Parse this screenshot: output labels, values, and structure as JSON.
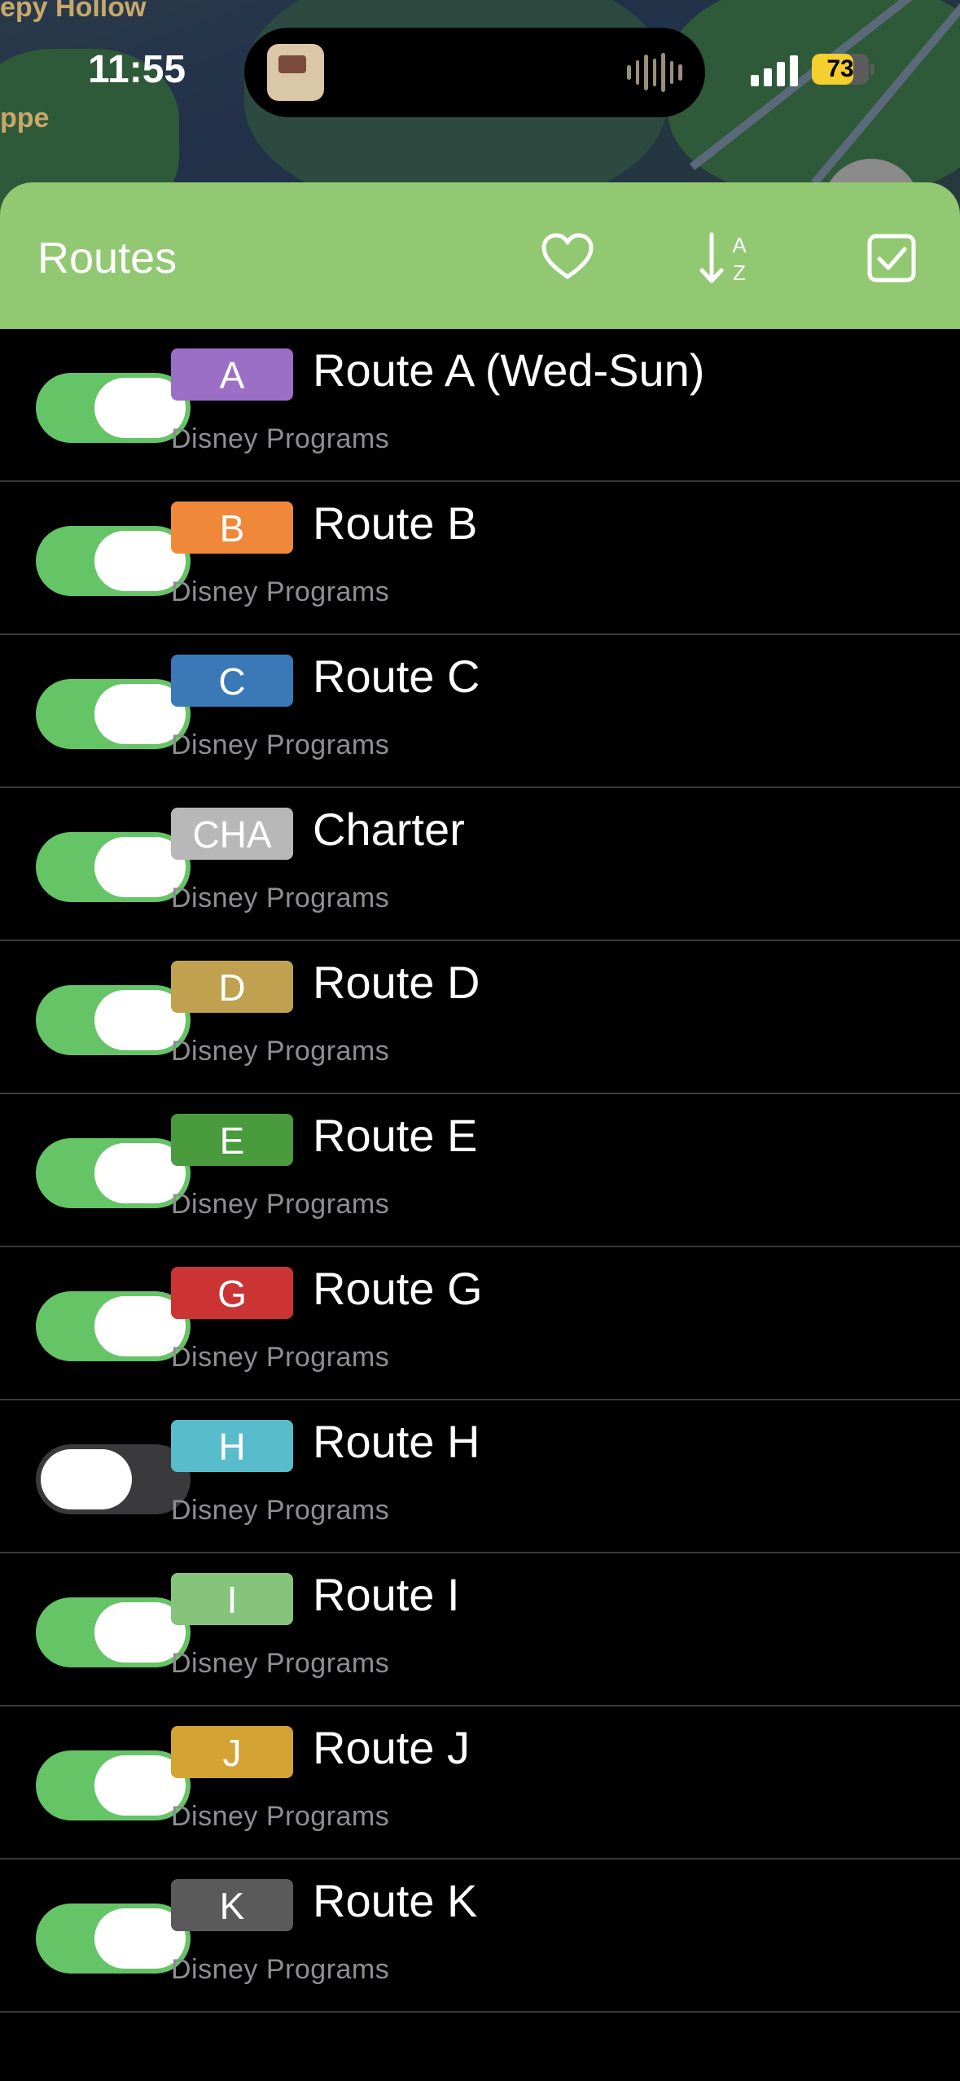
{
  "status_bar": {
    "time": "11:55",
    "battery": "73",
    "battery_level": 0.73,
    "battery_color": "#f4cf2e"
  },
  "map": {
    "labels": [
      "epy Hollow",
      "ppe"
    ]
  },
  "header": {
    "title": "Routes",
    "color": "#93c873",
    "icons": [
      "heart-icon",
      "sort-az-icon",
      "checkbox-icon"
    ]
  },
  "routes": [
    {
      "badge": "A",
      "name": "Route A (Wed-Sun)",
      "agency": "Disney Programs",
      "color": "#9b6fc6",
      "enabled": true
    },
    {
      "badge": "B",
      "name": "Route B",
      "agency": "Disney Programs",
      "color": "#f0883a",
      "enabled": true
    },
    {
      "badge": "C",
      "name": "Route C",
      "agency": "Disney Programs",
      "color": "#3a78b8",
      "enabled": true
    },
    {
      "badge": "CHA",
      "name": "Charter",
      "agency": "Disney Programs",
      "color": "#b8b8b8",
      "enabled": true
    },
    {
      "badge": "D",
      "name": "Route D",
      "agency": "Disney Programs",
      "color": "#bfa150",
      "enabled": true
    },
    {
      "badge": "E",
      "name": "Route E",
      "agency": "Disney Programs",
      "color": "#4a9a3e",
      "enabled": true
    },
    {
      "badge": "G",
      "name": "Route G",
      "agency": "Disney Programs",
      "color": "#cc3333",
      "enabled": true
    },
    {
      "badge": "H",
      "name": "Route H",
      "agency": "Disney Programs",
      "color": "#58bccc",
      "enabled": false
    },
    {
      "badge": "I",
      "name": "Route I",
      "agency": "Disney Programs",
      "color": "#86c47c",
      "enabled": true
    },
    {
      "badge": "J",
      "name": "Route J",
      "agency": "Disney Programs",
      "color": "#d4a334",
      "enabled": true
    },
    {
      "badge": "K",
      "name": "Route K",
      "agency": "Disney Programs",
      "color": "#5a5a5a",
      "enabled": true
    }
  ]
}
